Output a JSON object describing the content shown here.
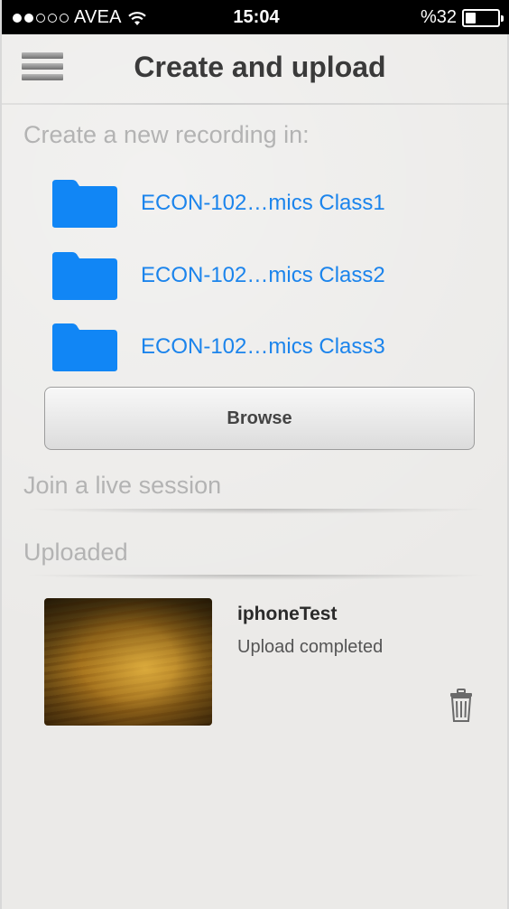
{
  "status_bar": {
    "signal_dots": [
      true,
      true,
      false,
      false,
      false
    ],
    "carrier": "AVEA",
    "time": "15:04",
    "battery_text": "%32",
    "battery_level": 0.32
  },
  "header": {
    "title": "Create and upload",
    "menu_icon": "hamburger-menu-icon"
  },
  "create_section": {
    "label": "Create a new recording in:",
    "folders": [
      {
        "label": "ECON-102…mics Class1",
        "icon": "folder-icon"
      },
      {
        "label": "ECON-102…mics Class2",
        "icon": "folder-icon"
      },
      {
        "label": "ECON-102…mics Class3",
        "icon": "folder-icon"
      }
    ],
    "browse_label": "Browse"
  },
  "live_section": {
    "label": "Join a live session"
  },
  "uploaded_section": {
    "label": "Uploaded",
    "items": [
      {
        "title": "iphoneTest",
        "status": "Upload completed",
        "delete_icon": "trash-icon"
      }
    ]
  },
  "colors": {
    "accent": "#1b84ec",
    "folder": "#1186f5",
    "background": "#ebeae8",
    "section_label": "#b3b3b3"
  }
}
